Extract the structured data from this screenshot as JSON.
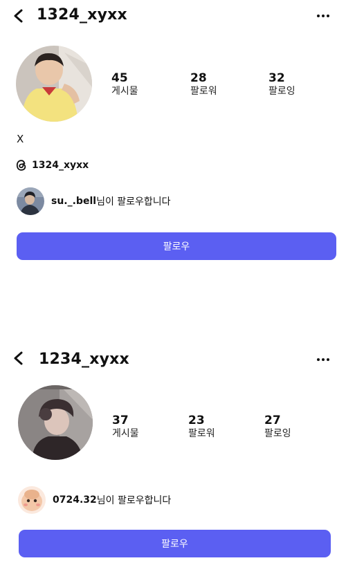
{
  "profiles": [
    {
      "username": "1324_xyxx",
      "stats": [
        {
          "value": "45",
          "label": "게시물"
        },
        {
          "value": "28",
          "label": "팔로워"
        },
        {
          "value": "32",
          "label": "팔로잉"
        }
      ],
      "bio": "X",
      "threads_handle": "1324_xyxx",
      "followed_by": {
        "user": "su._.bell",
        "suffix": "님이 팔로우합니다"
      },
      "follow_button": "팔로우"
    },
    {
      "username": "1234_xyxx",
      "stats": [
        {
          "value": "37",
          "label": "게시물"
        },
        {
          "value": "23",
          "label": "팔로워"
        },
        {
          "value": "27",
          "label": "팔로잉"
        }
      ],
      "followed_by": {
        "user": "0724.32",
        "suffix": "님이 팔로우합니다"
      },
      "follow_button": "팔로우"
    }
  ],
  "icons": {
    "back": "chevron-left-icon",
    "more": "more-horizontal-icon",
    "threads": "threads-logo-icon"
  },
  "colors": {
    "accent": "#5b5ff2",
    "text": "#111111",
    "background": "#ffffff"
  }
}
